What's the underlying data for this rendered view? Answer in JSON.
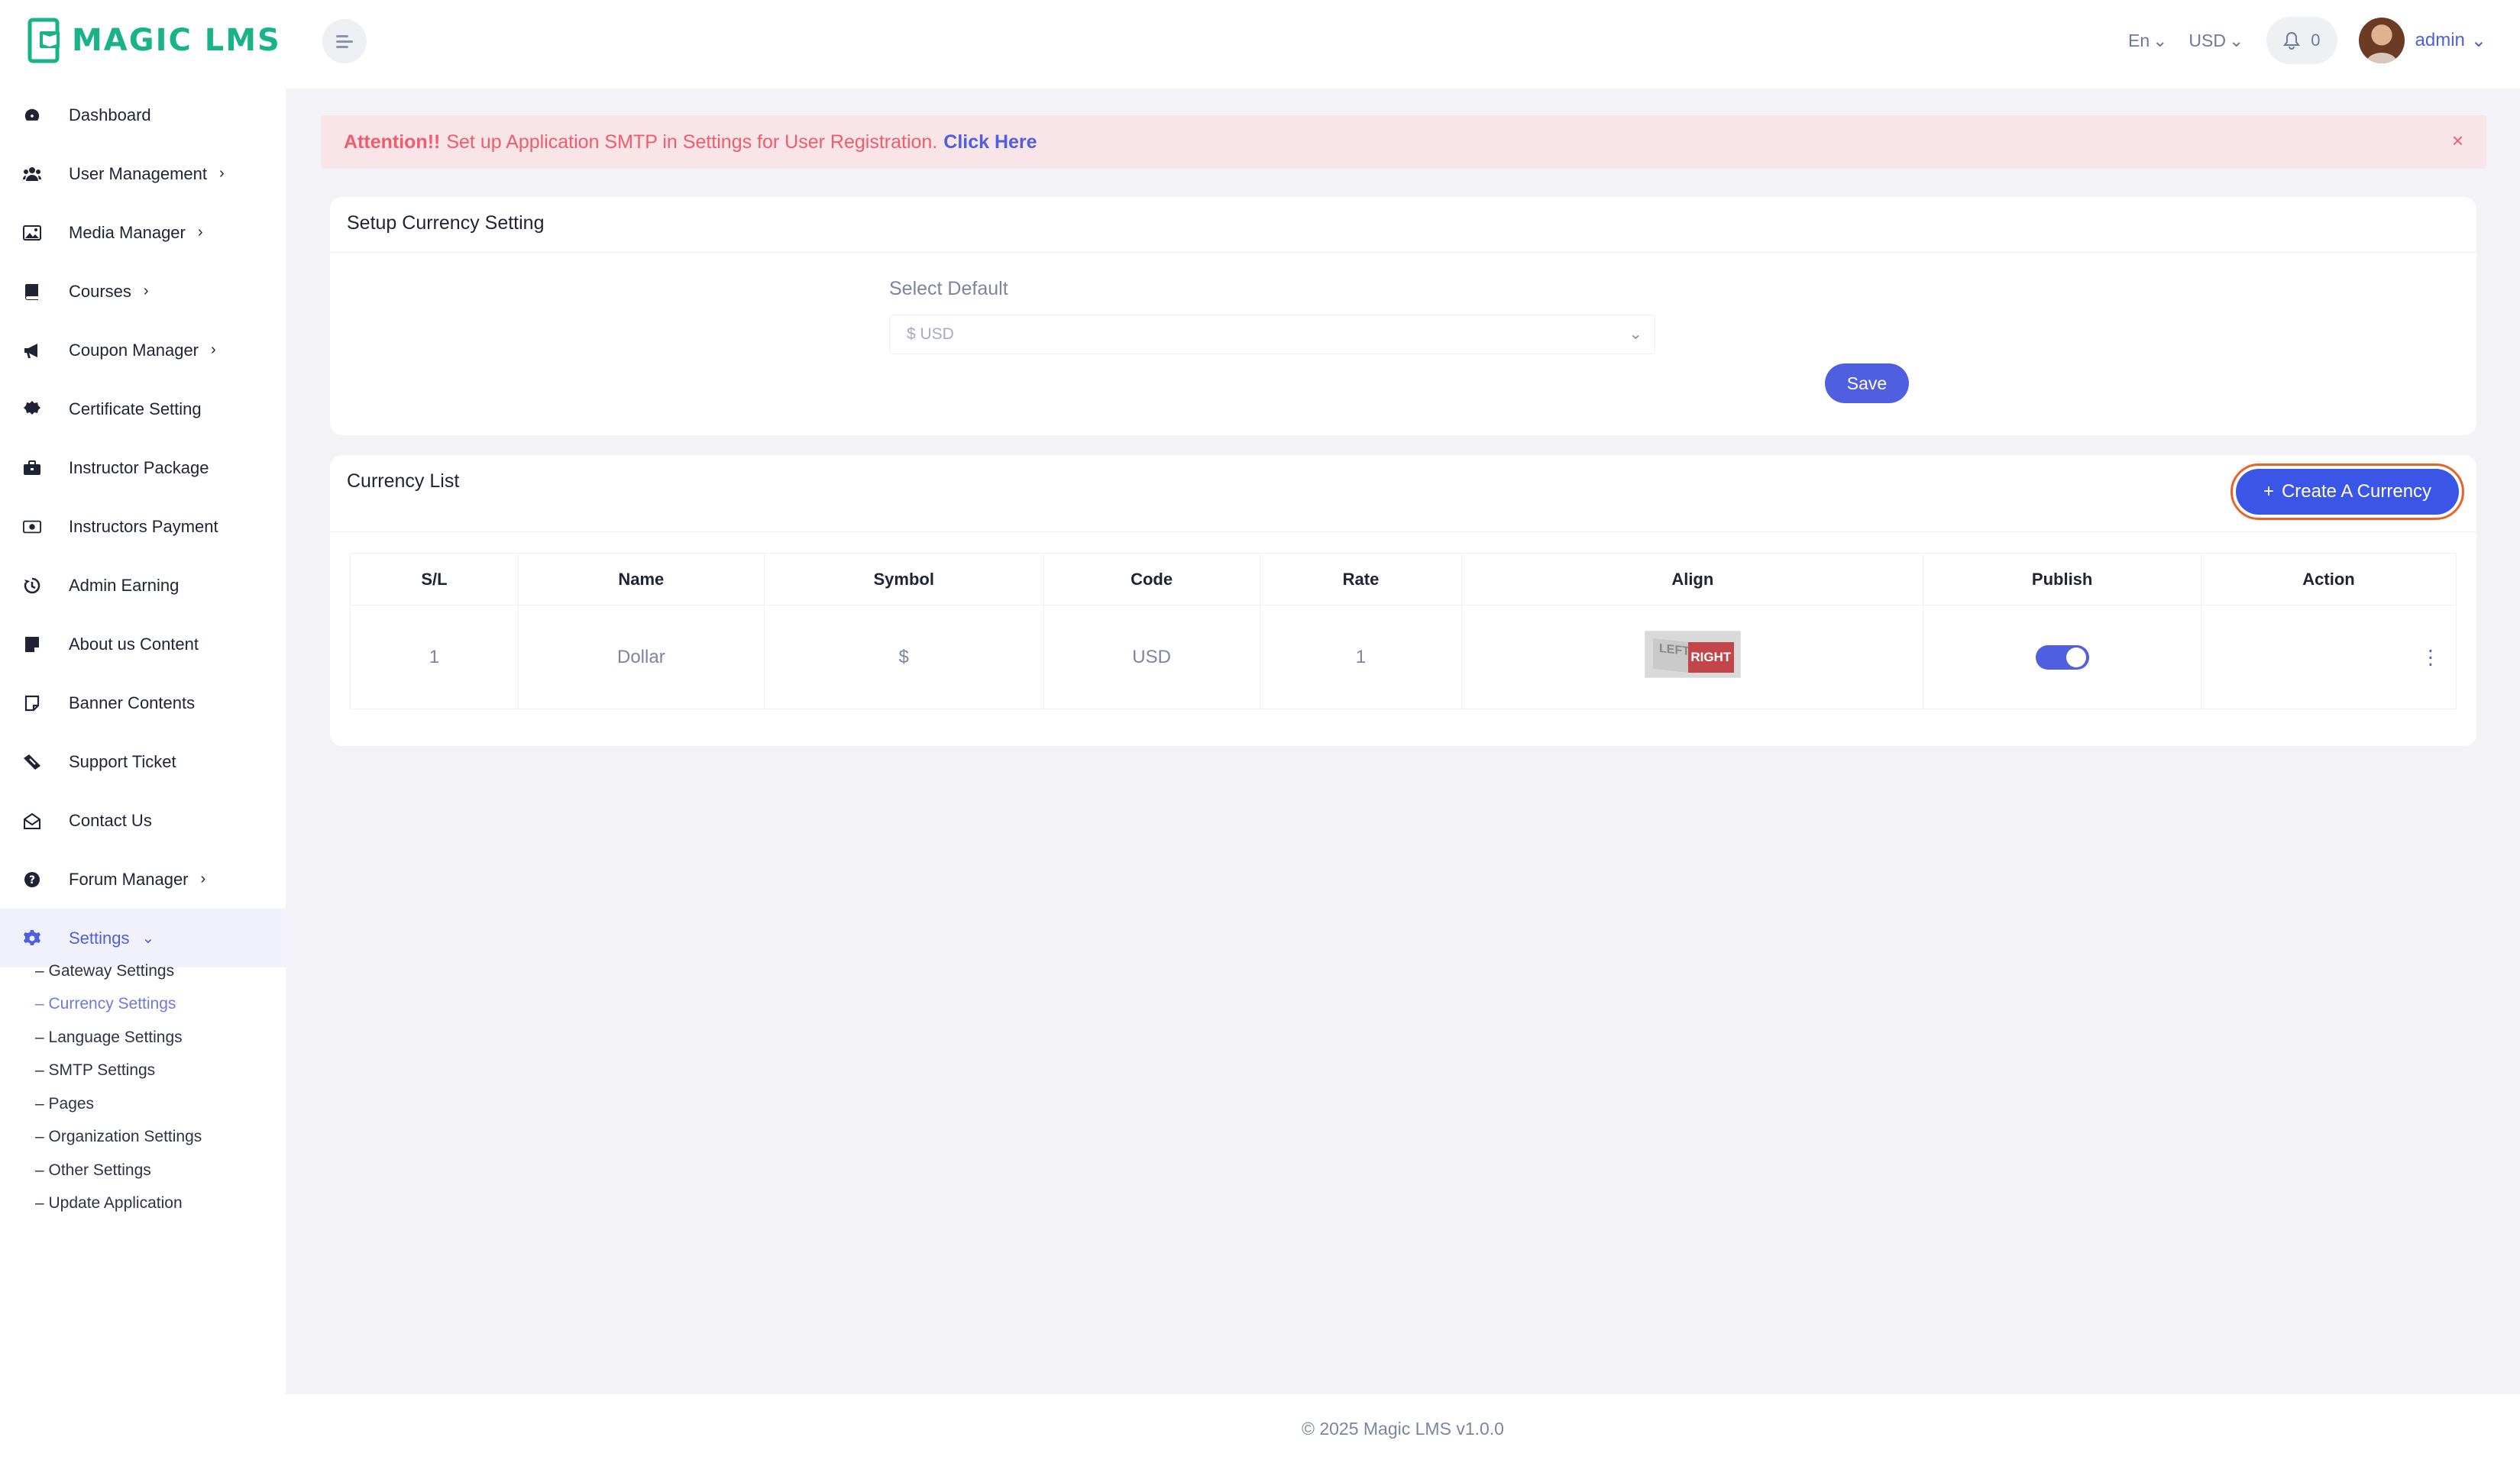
{
  "app": {
    "logo_text": "MAGIC LMS"
  },
  "sidebar": {
    "items": [
      {
        "label": "Dashboard",
        "icon": "dashboard-icon",
        "has_chevron": false
      },
      {
        "label": "User Management",
        "icon": "users-icon",
        "has_chevron": true
      },
      {
        "label": "Media Manager",
        "icon": "image-icon",
        "has_chevron": true
      },
      {
        "label": "Courses",
        "icon": "book-icon",
        "has_chevron": true
      },
      {
        "label": "Coupon Manager",
        "icon": "megaphone-icon",
        "has_chevron": true
      },
      {
        "label": "Certificate Setting",
        "icon": "certificate-icon",
        "has_chevron": false
      },
      {
        "label": "Instructor Package",
        "icon": "briefcase-icon",
        "has_chevron": false
      },
      {
        "label": "Instructors Payment",
        "icon": "money-icon",
        "has_chevron": false
      },
      {
        "label": "Admin Earning",
        "icon": "history-icon",
        "has_chevron": false
      },
      {
        "label": "About us Content",
        "icon": "note-icon",
        "has_chevron": false
      },
      {
        "label": "Banner Contents",
        "icon": "sticky-note-icon",
        "has_chevron": false
      },
      {
        "label": "Support Ticket",
        "icon": "ticket-icon",
        "has_chevron": false
      },
      {
        "label": "Contact Us",
        "icon": "envelope-open-icon",
        "has_chevron": false
      },
      {
        "label": "Forum Manager",
        "icon": "question-circle-icon",
        "has_chevron": true
      },
      {
        "label": "Settings",
        "icon": "gear-icon",
        "has_chevron": true,
        "active": true
      }
    ],
    "settings_sub": [
      "– Gateway Settings",
      "– Currency Settings",
      "– Language Settings",
      "– SMTP Settings",
      "– Pages",
      "– Organization Settings",
      "– Other Settings",
      "– Update Application"
    ],
    "active_sub": "– Currency Settings"
  },
  "header": {
    "language": "En",
    "currency": "USD",
    "notifications_count": "0",
    "user_name": "admin"
  },
  "alert": {
    "strong": "Attention!!",
    "text": "Set up Application SMTP in Settings for User Registration.",
    "link": "Click Here",
    "close": "×"
  },
  "setup_card": {
    "title": "Setup Currency Setting",
    "select_label": "Select Default",
    "select_value": "$ USD",
    "save_label": "Save"
  },
  "list_card": {
    "title": "Currency List",
    "create_label": "Create A Currency",
    "columns": [
      "S/L",
      "Name",
      "Symbol",
      "Code",
      "Rate",
      "Align",
      "Publish",
      "Action"
    ],
    "rows": [
      {
        "sl": "1",
        "name": "Dollar",
        "symbol": "$",
        "code": "USD",
        "rate": "1",
        "align_left": "LEFT",
        "align_right": "RIGHT",
        "published": true
      }
    ]
  },
  "footer": {
    "text": "© 2025 Magic LMS v1.0.0"
  },
  "colors": {
    "accent": "#4f5fe0",
    "brand": "#19b38a",
    "alert_text": "#ee5d6c",
    "alert_bg": "#f9e4e8"
  }
}
